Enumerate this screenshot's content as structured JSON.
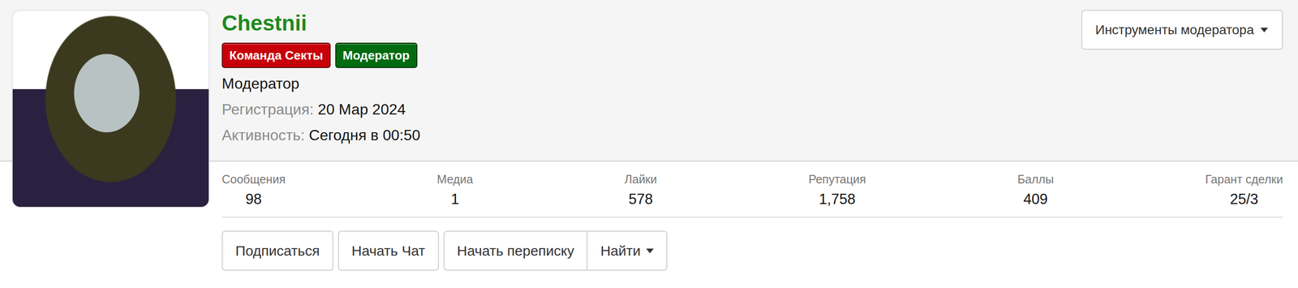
{
  "profile": {
    "name": "Chestnii",
    "badges": [
      {
        "label": "Команда Секты",
        "color": "#c8000a"
      },
      {
        "label": "Модератор",
        "color": "#006b10"
      }
    ],
    "title": "Модератор",
    "details": [
      {
        "label": "Регистрация:",
        "value": "20 Мар 2024"
      },
      {
        "label": "Активность:",
        "value": "Сегодня в 00:50"
      }
    ]
  },
  "moderator_tools": {
    "label": "Инструменты модератора"
  },
  "stats": [
    {
      "label": "Сообщения",
      "value": "98"
    },
    {
      "label": "Медиа",
      "value": "1"
    },
    {
      "label": "Лайки",
      "value": "578"
    },
    {
      "label": "Репутация",
      "value": "1,758"
    },
    {
      "label": "Баллы",
      "value": "409"
    },
    {
      "label": "Гарант сделки",
      "value": "25/3"
    }
  ],
  "actions": [
    [
      {
        "label": "Подписаться",
        "kind": "button"
      }
    ],
    [
      {
        "label": "Начать Чат",
        "kind": "button"
      }
    ],
    [
      {
        "label": "Начать переписку",
        "kind": "button"
      },
      {
        "label": "Найти",
        "kind": "dropdown"
      }
    ]
  ]
}
